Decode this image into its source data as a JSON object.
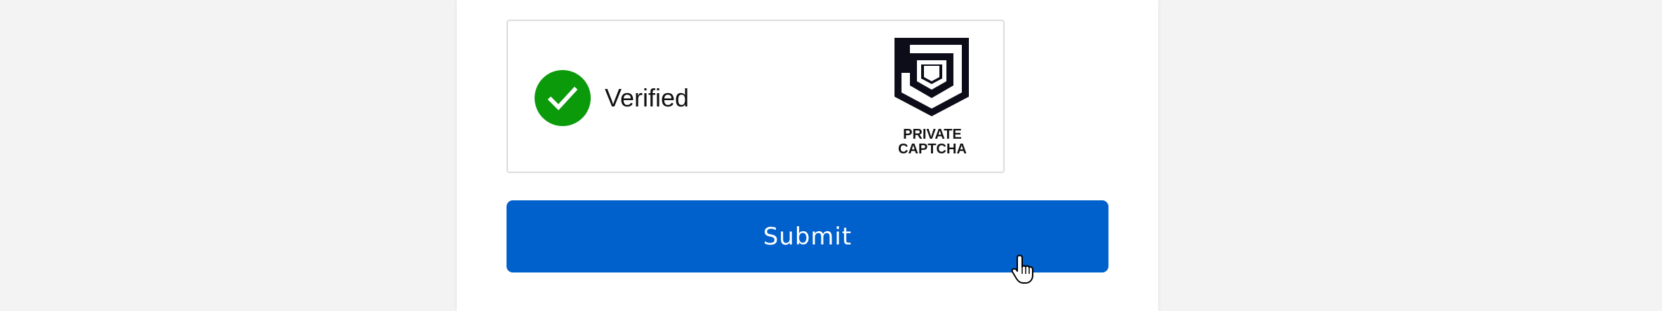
{
  "captcha": {
    "status_label": "Verified",
    "status_icon": "checkmark-icon",
    "status_color": "#0a9a0a",
    "brand_line1": "PRIVATE",
    "brand_line2": "CAPTCHA",
    "brand_icon": "private-captcha-shield-logo"
  },
  "form": {
    "submit_label": "Submit",
    "submit_color": "#0060cc"
  },
  "cursor_icon": "hand-pointer-icon"
}
